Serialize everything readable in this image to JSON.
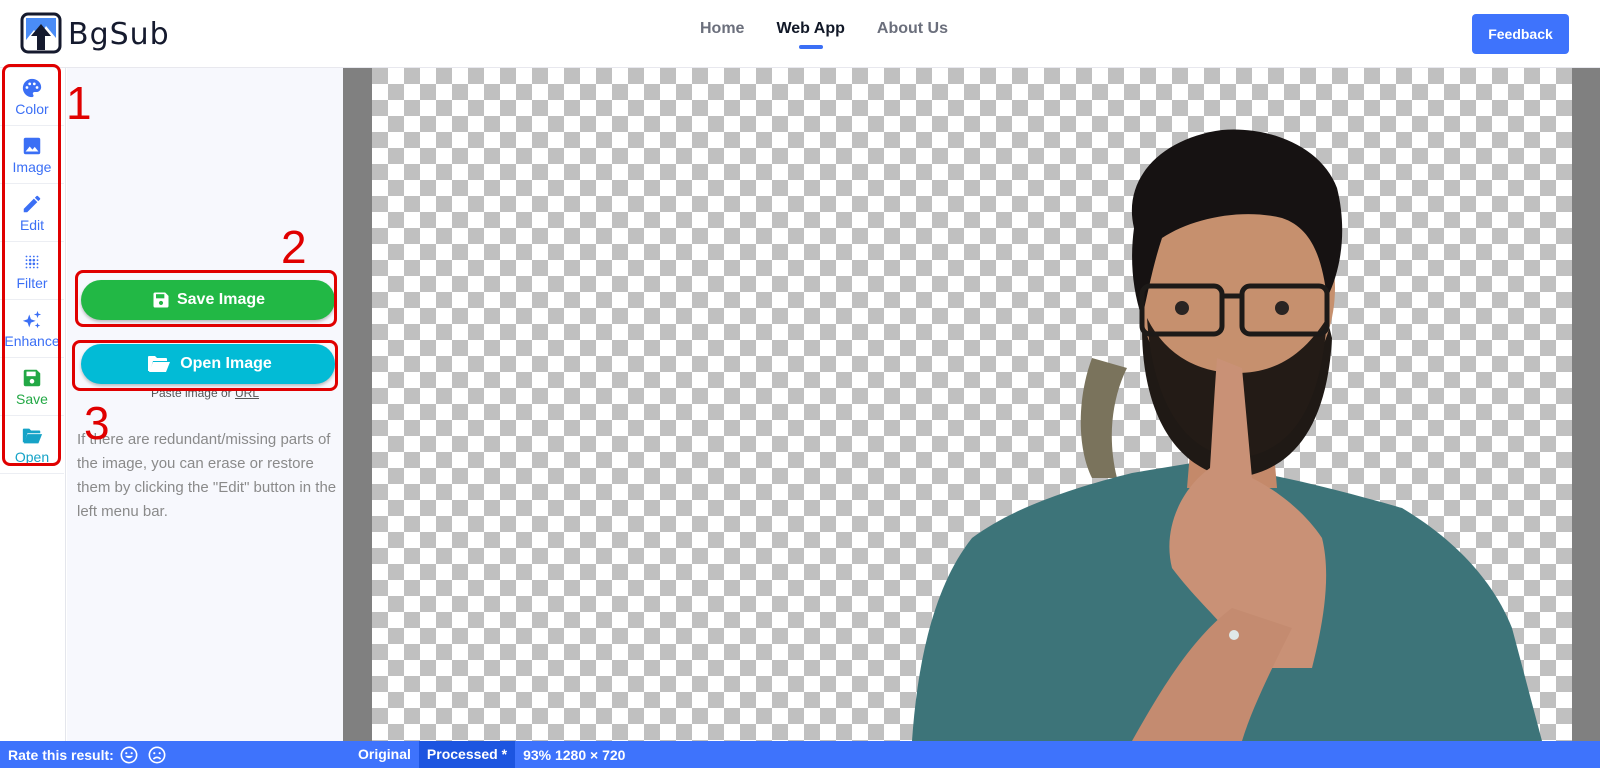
{
  "brand": {
    "name": "BgSub"
  },
  "nav": {
    "items": [
      {
        "label": "Home",
        "active": false
      },
      {
        "label": "Web App",
        "active": true
      },
      {
        "label": "About Us",
        "active": false
      }
    ],
    "feedback_label": "Feedback"
  },
  "toolbar": {
    "items": [
      {
        "label": "Color",
        "icon": "palette-icon"
      },
      {
        "label": "Image",
        "icon": "image-icon"
      },
      {
        "label": "Edit",
        "icon": "pencil-icon"
      },
      {
        "label": "Filter",
        "icon": "filter-dots-icon"
      },
      {
        "label": "Enhance",
        "icon": "sparkles-icon"
      },
      {
        "label": "Save",
        "icon": "floppy-disk-icon"
      },
      {
        "label": "Open",
        "icon": "folder-open-icon"
      }
    ]
  },
  "panel": {
    "save_label": "Save Image",
    "open_label": "Open Image",
    "paste_text": "Paste image or",
    "paste_link": "URL",
    "hint": "If there are redundant/missing parts of the image, you can erase or restore them by clicking the \"Edit\" button in the left menu bar."
  },
  "annotations": [
    "1",
    "2",
    "3"
  ],
  "statusbar": {
    "rate_label": "Rate this result:",
    "tabs": [
      {
        "label": "Original",
        "active": false
      },
      {
        "label": "Processed *",
        "active": true
      }
    ],
    "zoom_info": "93% 1280 × 720"
  },
  "colors": {
    "accent": "#3e73fc",
    "save_green": "#22b845",
    "open_cyan": "#02bbd6",
    "annotation_red": "#e00000"
  }
}
